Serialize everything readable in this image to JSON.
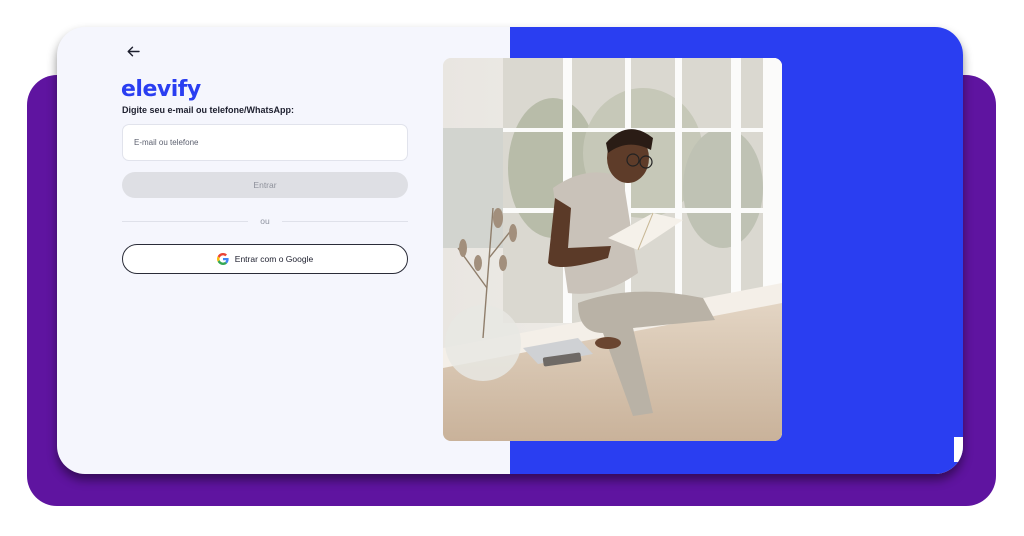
{
  "login": {
    "back_icon": "arrow-left-icon",
    "logo_text": "elevify",
    "prompt": "Digite seu e-mail ou telefone/WhatsApp:",
    "email_placeholder": "E-mail ou telefone",
    "email_value": "",
    "enter_label": "Entrar",
    "divider_text": "ou",
    "google_label": "Entrar com o Google",
    "google_icon": "google-icon"
  },
  "colors": {
    "brand_blue": "#2a3ef1",
    "backdrop_purple": "#5f14a0",
    "card_background": "#f5f6fd",
    "button_disabled": "#dedfe4"
  },
  "hero": {
    "image": "photo-man-reading-book-by-window"
  }
}
